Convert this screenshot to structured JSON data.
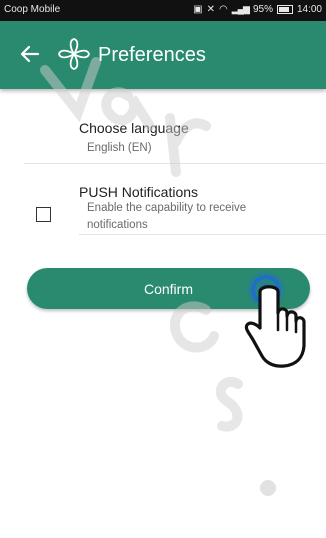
{
  "status_bar": {
    "carrier": "Coop Mobile",
    "battery": "95%",
    "time": "14:00"
  },
  "app_bar": {
    "title": "Preferences",
    "back_icon": "arrow-left-icon",
    "logo_icon": "flower-logo-icon"
  },
  "language": {
    "title": "Choose language",
    "value": "English (EN)"
  },
  "push": {
    "title": "PUSH Notifications",
    "description_line1": "Enable the capability to receive",
    "description_line2": "notifications",
    "checked": false
  },
  "confirm_label": "Confirm",
  "colors": {
    "brand": "#2a8a6f",
    "status_bar": "#111111",
    "tap_ring": "#1f6ec8"
  }
}
